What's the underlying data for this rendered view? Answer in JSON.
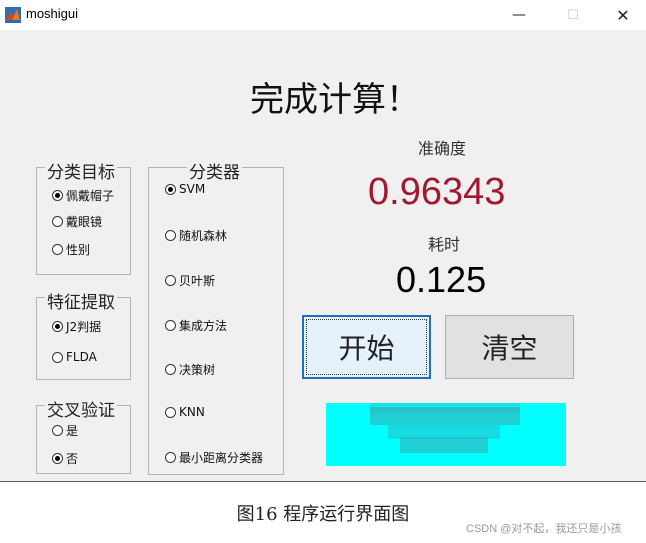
{
  "window": {
    "title": "moshigui",
    "minimize_icon": "—",
    "maximize_icon": "☐",
    "close_icon": "✕"
  },
  "status_title": "完成计算！",
  "groups": {
    "target": {
      "legend": "分类目标",
      "options": [
        "佩戴帽子",
        "戴眼镜",
        "性别"
      ],
      "selected": "佩戴帽子"
    },
    "feature": {
      "legend": "特征提取",
      "options": [
        "J2判据",
        "FLDA"
      ],
      "selected": "J2判据"
    },
    "cross_validation": {
      "legend": "交叉验证",
      "options": [
        "是",
        "否"
      ],
      "selected": "否"
    },
    "classifier": {
      "legend": "分类器",
      "options": [
        "SVM",
        "随机森林",
        "贝叶斯",
        "集成方法",
        "决策树",
        "KNN",
        "最小距离分类器"
      ],
      "selected": "SVM"
    }
  },
  "metrics": {
    "accuracy_label": "准确度",
    "accuracy_value": "0.96343",
    "time_label": "耗时",
    "time_value": "0.125"
  },
  "buttons": {
    "start": "开始",
    "clear": "清空"
  },
  "colors": {
    "accuracy": "#a1192f",
    "result_panel": "#00ffff",
    "start_border": "#1f6fc0"
  },
  "caption": "图16   程序运行界面图",
  "watermark": "CSDN @对不起，我还只是小孩"
}
